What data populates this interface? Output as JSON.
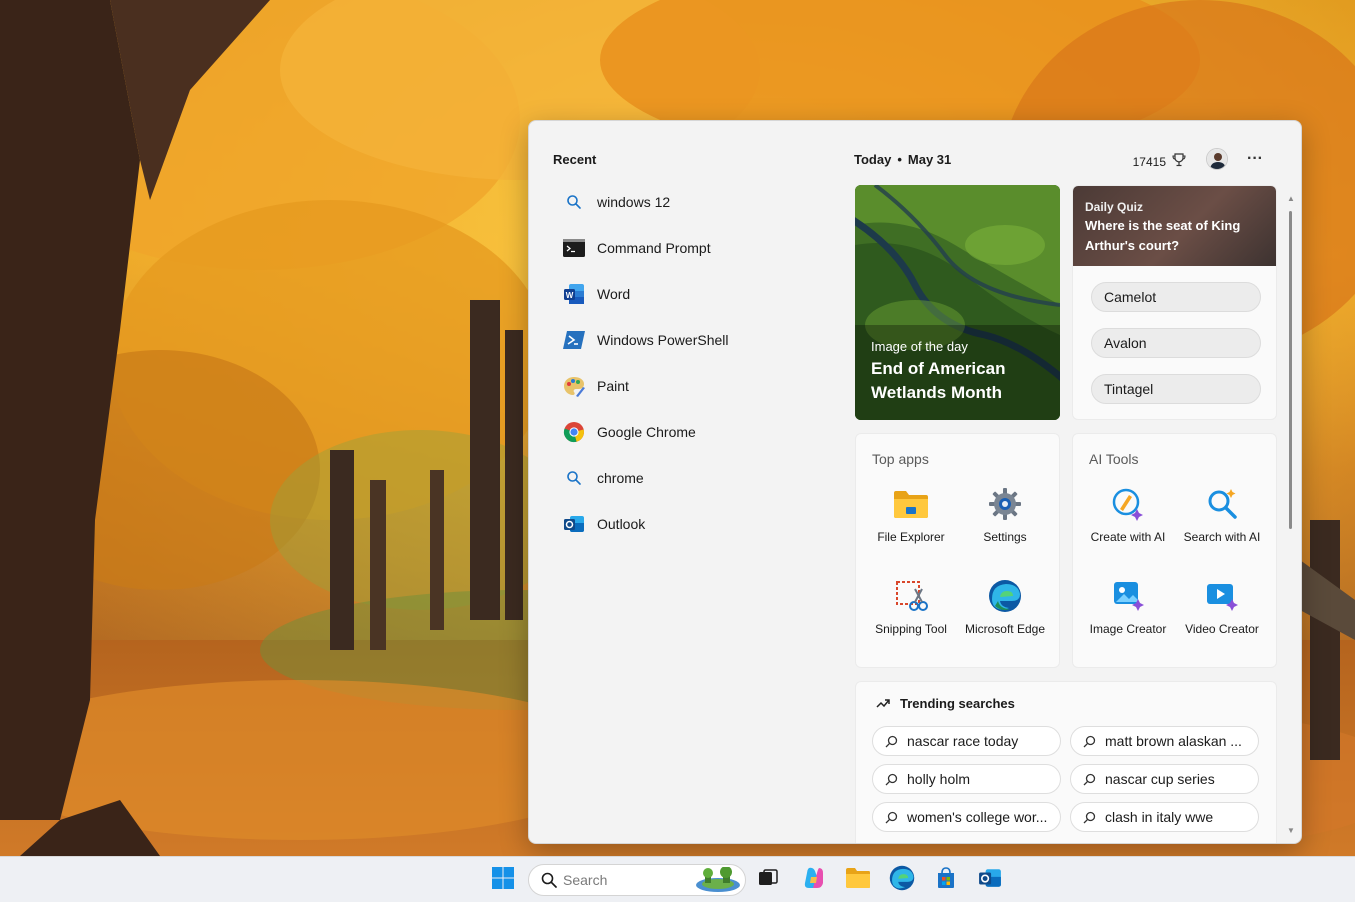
{
  "recent": {
    "heading": "Recent",
    "items": [
      {
        "label": "windows 12",
        "icon": "search-icon"
      },
      {
        "label": "Command Prompt",
        "icon": "command-prompt-icon"
      },
      {
        "label": "Word",
        "icon": "word-icon"
      },
      {
        "label": "Windows PowerShell",
        "icon": "powershell-icon"
      },
      {
        "label": "Paint",
        "icon": "paint-icon"
      },
      {
        "label": "Google Chrome",
        "icon": "chrome-icon"
      },
      {
        "label": "chrome",
        "icon": "search-icon"
      },
      {
        "label": "Outlook",
        "icon": "outlook-icon"
      }
    ]
  },
  "header": {
    "today": "Today",
    "separator": "•",
    "date": "May 31",
    "points": "17415",
    "more_label": "···"
  },
  "image_of_day": {
    "overline": "Image of the day",
    "title": "End of American Wetlands Month"
  },
  "quiz": {
    "overline": "Daily Quiz",
    "question": "Where is the seat of King Arthur's court?",
    "options": [
      "Camelot",
      "Avalon",
      "Tintagel"
    ]
  },
  "top_apps": {
    "heading": "Top apps",
    "apps": [
      {
        "label": "File Explorer",
        "icon": "file-explorer-icon"
      },
      {
        "label": "Settings",
        "icon": "settings-gear-icon"
      },
      {
        "label": "Snipping Tool",
        "icon": "snipping-tool-icon"
      },
      {
        "label": "Microsoft Edge",
        "icon": "edge-icon"
      }
    ]
  },
  "ai_tools": {
    "heading": "AI Tools",
    "tools": [
      {
        "label": "Create with AI",
        "icon": "create-ai-icon"
      },
      {
        "label": "Search with AI",
        "icon": "search-ai-icon"
      },
      {
        "label": "Image Creator",
        "icon": "image-creator-icon"
      },
      {
        "label": "Video Creator",
        "icon": "video-creator-icon"
      }
    ]
  },
  "trending": {
    "heading": "Trending searches",
    "items": [
      "nascar race today",
      "matt brown alaskan ...",
      "holly holm",
      "nascar cup series",
      "women's college wor...",
      "clash in italy wwe"
    ]
  },
  "taskbar": {
    "search_placeholder": "Search",
    "pinned": [
      "start-icon",
      "task-view-icon",
      "copilot-icon",
      "file-explorer-icon",
      "edge-icon",
      "store-icon",
      "outlook-icon"
    ]
  },
  "colors": {
    "accent": "#0067c0",
    "panel_bg": "#f3f3f3",
    "taskbar_bg": "#eef0f4"
  }
}
